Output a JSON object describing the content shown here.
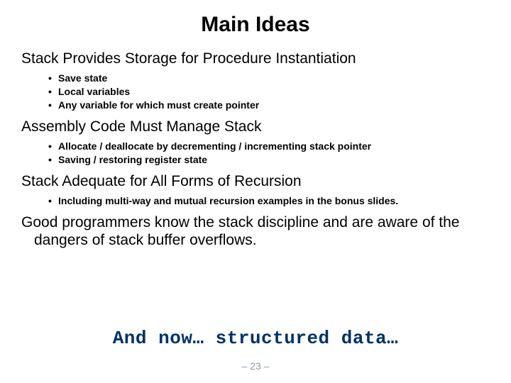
{
  "title": "Main Ideas",
  "section1": {
    "heading": "Stack Provides Storage for Procedure Instantiation",
    "b1": "Save state",
    "b2": "Local variables",
    "b3": "Any variable for which must create pointer"
  },
  "section2": {
    "heading": "Assembly Code Must Manage Stack",
    "b1": "Allocate / deallocate by decrementing / incrementing stack pointer",
    "b2": "Saving / restoring register state"
  },
  "section3": {
    "heading": "Stack Adequate for All Forms of Recursion",
    "b1": "Including multi-way and mutual recursion examples in the bonus slides."
  },
  "section4": {
    "heading": "Good programmers know the stack discipline and are aware of the dangers of stack buffer overflows."
  },
  "footer": "And now… structured data…",
  "page": "– 23 –"
}
